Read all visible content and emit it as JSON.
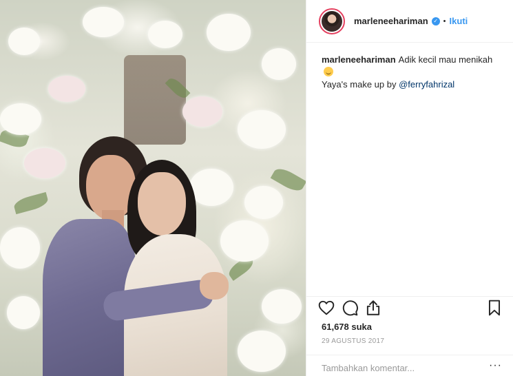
{
  "post": {
    "photo_alt": "",
    "header": {
      "username": "marleneehariman",
      "verified_icon": "verified-badge-icon",
      "separator": "•",
      "follow_label": "Ikuti"
    },
    "caption": {
      "username": "marleneehariman",
      "text": "Adik kecil mau menikah",
      "emoji": "smiling-face-icon",
      "line2_text": "Yaya's make up by",
      "mention": "@ferryfahrizal"
    },
    "actions": {
      "like_icon": "heart-icon",
      "comment_icon": "comment-bubble-icon",
      "share_icon": "share-icon",
      "save_icon": "bookmark-icon"
    },
    "likes_text": "61,678 suka",
    "date_text": "29 AGUSTUS 2017",
    "comment": {
      "placeholder": "Tambahkan komentar...",
      "more_label": "···"
    },
    "colors": {
      "accent_blue": "#3897f0",
      "text": "#262626",
      "muted": "#999999",
      "border": "#efefef",
      "avatar_ring": "#e4405f",
      "mention": "#003569"
    }
  }
}
